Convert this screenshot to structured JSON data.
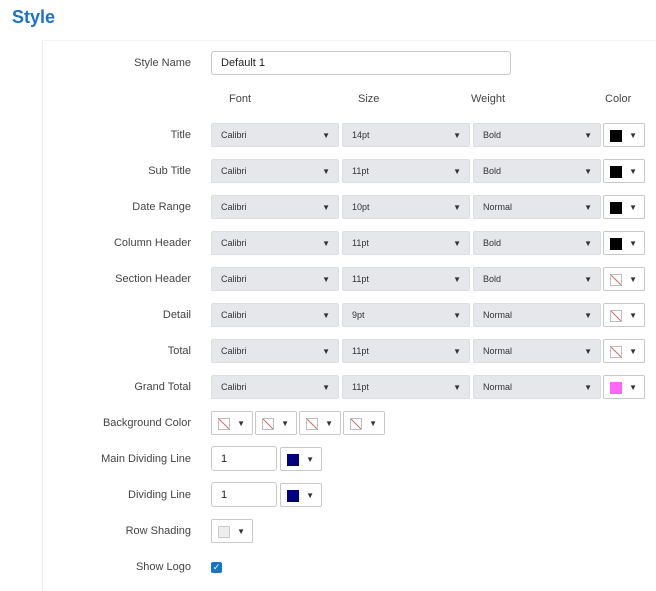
{
  "page_title": "Style",
  "style_name": {
    "label": "Style Name",
    "value": "Default 1"
  },
  "columns": {
    "font": "Font",
    "size": "Size",
    "weight": "Weight",
    "color": "Color"
  },
  "rows": [
    {
      "label": "Title",
      "font": "Calibri",
      "size": "14pt",
      "weight": "Bold",
      "color": "#000000"
    },
    {
      "label": "Sub Title",
      "font": "Calibri",
      "size": "11pt",
      "weight": "Bold",
      "color": "#000000"
    },
    {
      "label": "Date Range",
      "font": "Calibri",
      "size": "10pt",
      "weight": "Normal",
      "color": "#000000"
    },
    {
      "label": "Column Header",
      "font": "Calibri",
      "size": "11pt",
      "weight": "Bold",
      "color": "#000000"
    },
    {
      "label": "Section Header",
      "font": "Calibri",
      "size": "11pt",
      "weight": "Bold",
      "color": "none"
    },
    {
      "label": "Detail",
      "font": "Calibri",
      "size": "9pt",
      "weight": "Normal",
      "color": "none"
    },
    {
      "label": "Total",
      "font": "Calibri",
      "size": "11pt",
      "weight": "Normal",
      "color": "none"
    },
    {
      "label": "Grand Total",
      "font": "Calibri",
      "size": "11pt",
      "weight": "Normal",
      "color": "#ff66ff"
    }
  ],
  "background_color": {
    "label": "Background Color",
    "swatches": [
      "none",
      "none",
      "none",
      "none"
    ]
  },
  "main_dividing_line": {
    "label": "Main Dividing Line",
    "value": "1",
    "color": "#000080"
  },
  "dividing_line": {
    "label": "Dividing Line",
    "value": "1",
    "color": "#000080"
  },
  "row_shading": {
    "label": "Row Shading",
    "color": "#eeeeee"
  },
  "show_logo": {
    "label": "Show Logo",
    "checked": true
  },
  "icons": {
    "dropdown": "▼",
    "check": "✓"
  }
}
